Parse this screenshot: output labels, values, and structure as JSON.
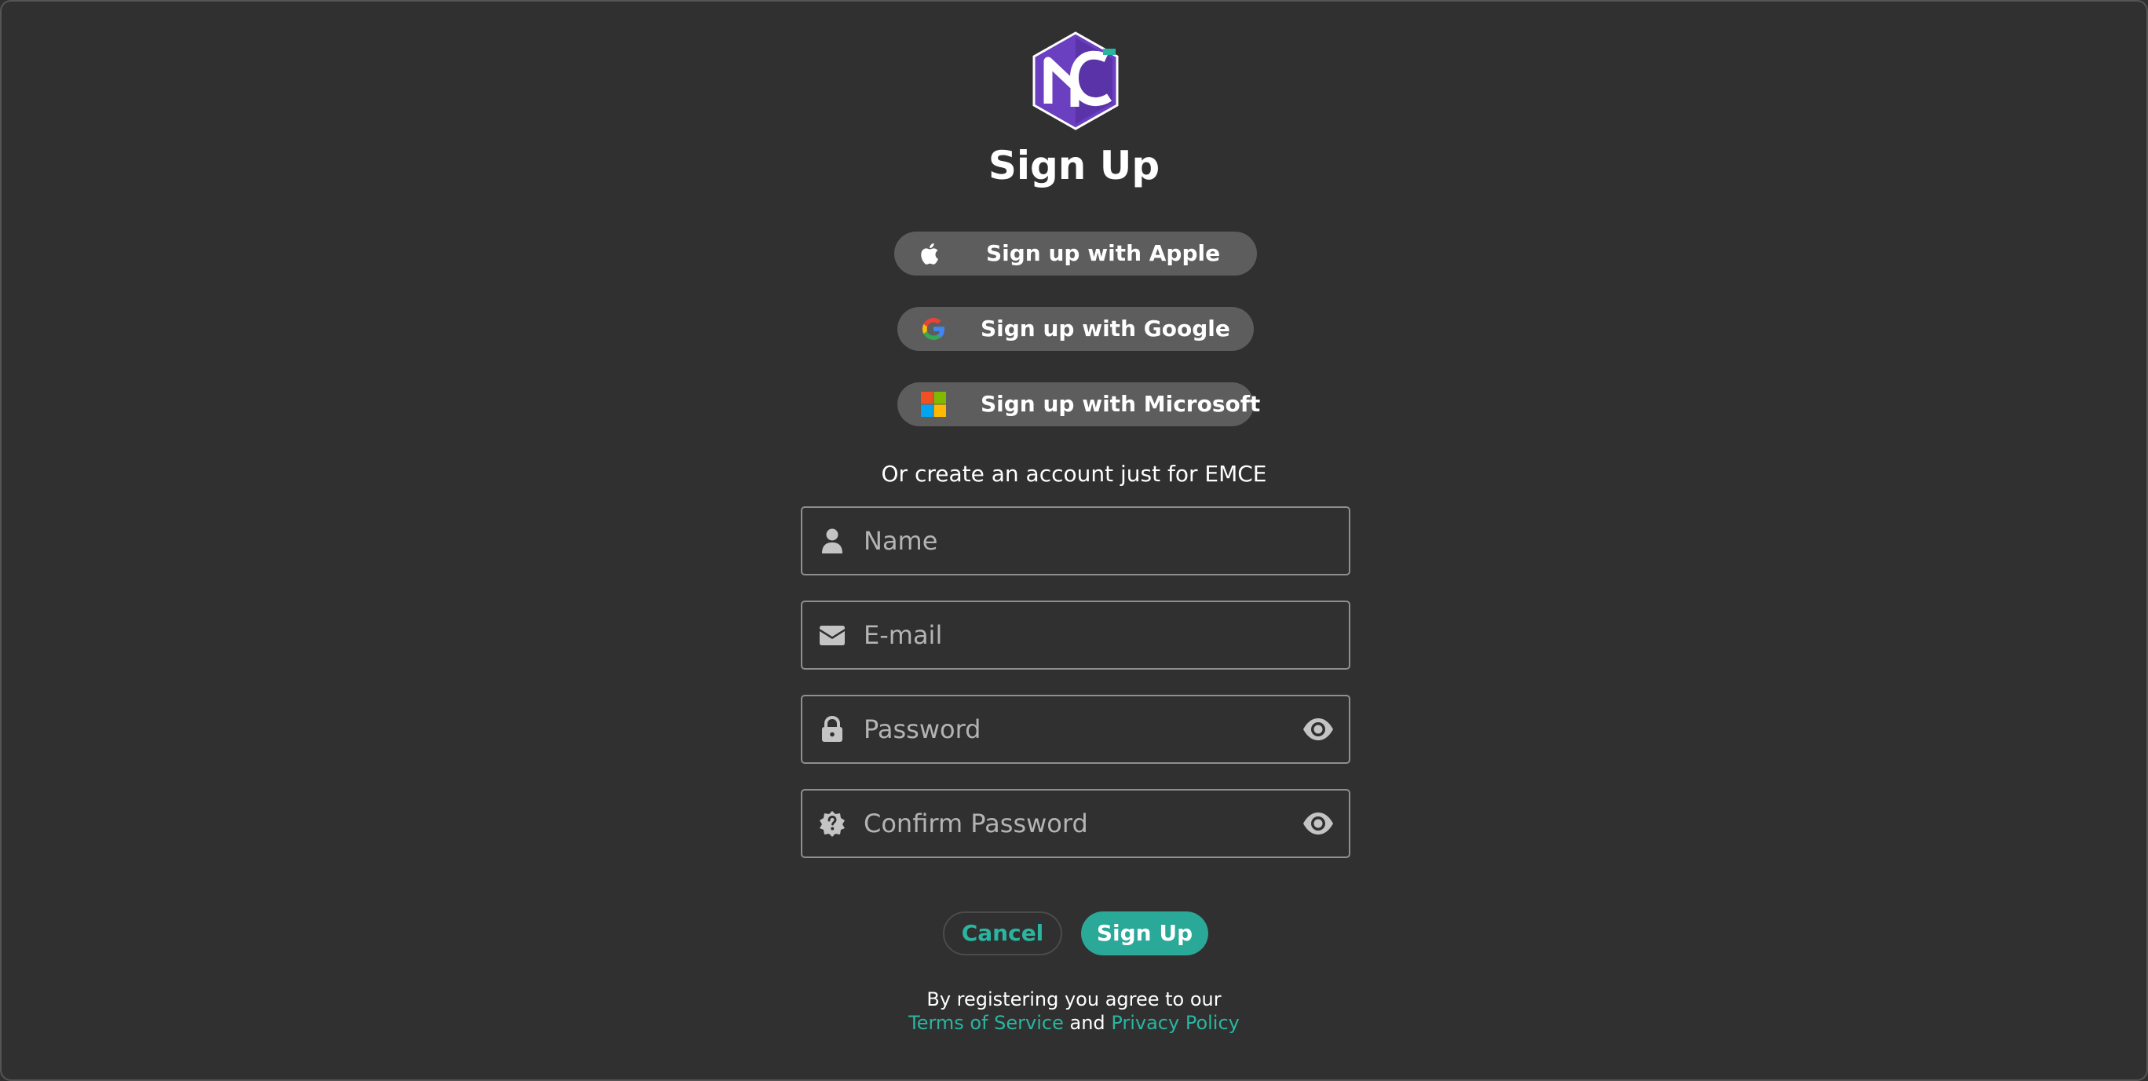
{
  "brand": {
    "logo_letters": "MC",
    "accent_color": "#2aa898",
    "logo_color": "#6a3fc0"
  },
  "page": {
    "title": "Sign Up"
  },
  "oauth": {
    "apple_label": "Sign up with Apple",
    "google_label": "Sign up with Google",
    "microsoft_label": "Sign up with Microsoft"
  },
  "divider_text": "Or create an account just for EMCE",
  "form": {
    "name_placeholder": "Name",
    "email_placeholder": "E-mail",
    "password_placeholder": "Password",
    "confirm_placeholder": "Confirm Password"
  },
  "actions": {
    "cancel_label": "Cancel",
    "signup_label": "Sign Up"
  },
  "legal": {
    "prefix": "By registering you agree to our",
    "terms": "Terms of Service",
    "and": "and",
    "privacy": "Privacy Policy"
  },
  "icons": {
    "apple": "apple-icon",
    "google": "google-icon",
    "microsoft": "microsoft-icon",
    "name": "user-icon",
    "email": "envelope-icon",
    "password": "lock-icon",
    "confirm": "shield-question-icon",
    "toggle": "eye-icon"
  }
}
